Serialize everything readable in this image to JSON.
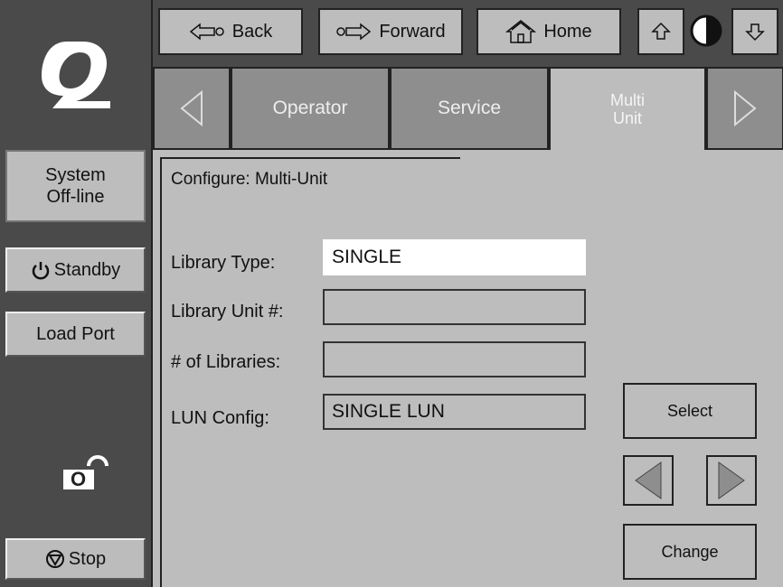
{
  "sidebar": {
    "system_status": [
      "System",
      "Off-line"
    ],
    "standby_label": "Standby",
    "loadport_label": "Load Port",
    "stop_label": "Stop",
    "lock_letter": "O"
  },
  "topnav": {
    "back_label": "Back",
    "forward_label": "Forward",
    "home_label": "Home"
  },
  "tabs": {
    "operator": "Operator",
    "service": "Service",
    "multi_unit": [
      "Multi",
      "Unit"
    ]
  },
  "page": {
    "title": "Configure: Multi-Unit",
    "fields": [
      {
        "label": "Library Type:",
        "value": "SINGLE"
      },
      {
        "label": "Library Unit #:",
        "value": ""
      },
      {
        "label": "# of Libraries:",
        "value": ""
      },
      {
        "label": "LUN Config:",
        "value": "SINGLE LUN"
      }
    ],
    "select_label": "Select",
    "change_label": "Change"
  },
  "colors": {
    "sidebar_bg": "#4a4a4a",
    "panel_bg": "#bdbdbd",
    "tab_inactive": "#8e8e8e"
  }
}
